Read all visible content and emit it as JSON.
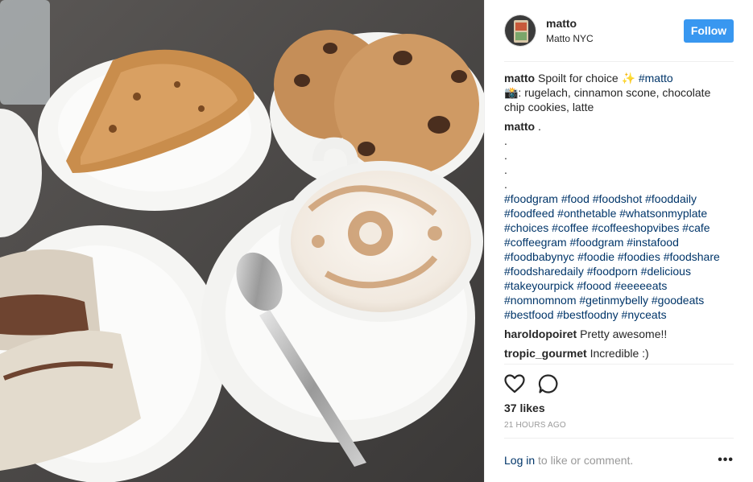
{
  "post": {
    "username": "matto",
    "location": "Matto NYC",
    "follow_label": "Follow",
    "caption": {
      "username": "matto",
      "text_before": "Spoilt for choice ✨ ",
      "hashtag": "#matto",
      "line2": "📸: rugelach, cinnamon scone, chocolate chip cookies, latte"
    },
    "author_comment": {
      "username": "matto",
      "text": ".",
      "dots": [
        ".",
        ".",
        ".",
        "."
      ],
      "hashtags": "#foodgram #food #foodshot #fooddaily #foodfeed #onthetable #whatsonmyplate #choices #coffee #coffeeshopvibes #cafe #coffeegram #foodgram #instafood #foodbabynyc #foodie #foodies #foodshare #foodsharedaily #foodporn #delicious #takeyourpick #foood #eeeeeats #nomnomnom #getinmybelly #goodeats #bestfood #bestfoodny #nyceats"
    },
    "comments": [
      {
        "username": "haroldopoiret",
        "text": "Pretty awesome!!"
      },
      {
        "username": "tropic_gourmet",
        "text": "Incredible :)"
      }
    ],
    "likes": "37 likes",
    "timestamp": "21 HOURS AGO",
    "login_link": "Log in",
    "login_rest": " to like or comment.",
    "more_label": "•••",
    "icons": {
      "like": "heart-icon",
      "comment": "comment-bubble-icon",
      "options": "more-options-icon"
    },
    "colors": {
      "accent": "#3897f0",
      "hashtag": "#003569",
      "muted": "#999999"
    }
  }
}
